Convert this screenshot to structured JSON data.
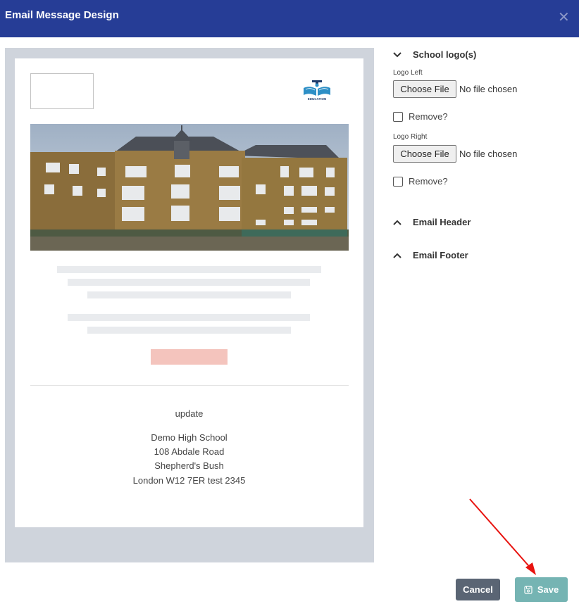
{
  "dialog": {
    "title": "Email Message Design",
    "close_icon": "close-icon"
  },
  "preview": {
    "logo_right_caption": "EDUCATION",
    "footer": {
      "update": "update",
      "school_name": "Demo High School",
      "address_1": "108 Abdale Road",
      "address_2": "Shepherd's Bush",
      "address_3": "London W12 7ER test 2345"
    }
  },
  "settings": {
    "sections": {
      "logos": "School logo(s)",
      "header": "Email Header",
      "footer": "Email Footer"
    },
    "logo_left": {
      "label": "Logo Left",
      "button": "Choose File",
      "status": "No file chosen",
      "remove": "Remove?"
    },
    "logo_right": {
      "label": "Logo Right",
      "button": "Choose File",
      "status": "No file chosen",
      "remove": "Remove?"
    }
  },
  "actions": {
    "cancel": "Cancel",
    "save": "Save"
  },
  "colors": {
    "header": "#263d96",
    "save": "#75b4b3",
    "cancel": "#5a6574",
    "annotation_arrow": "#e8130f"
  }
}
